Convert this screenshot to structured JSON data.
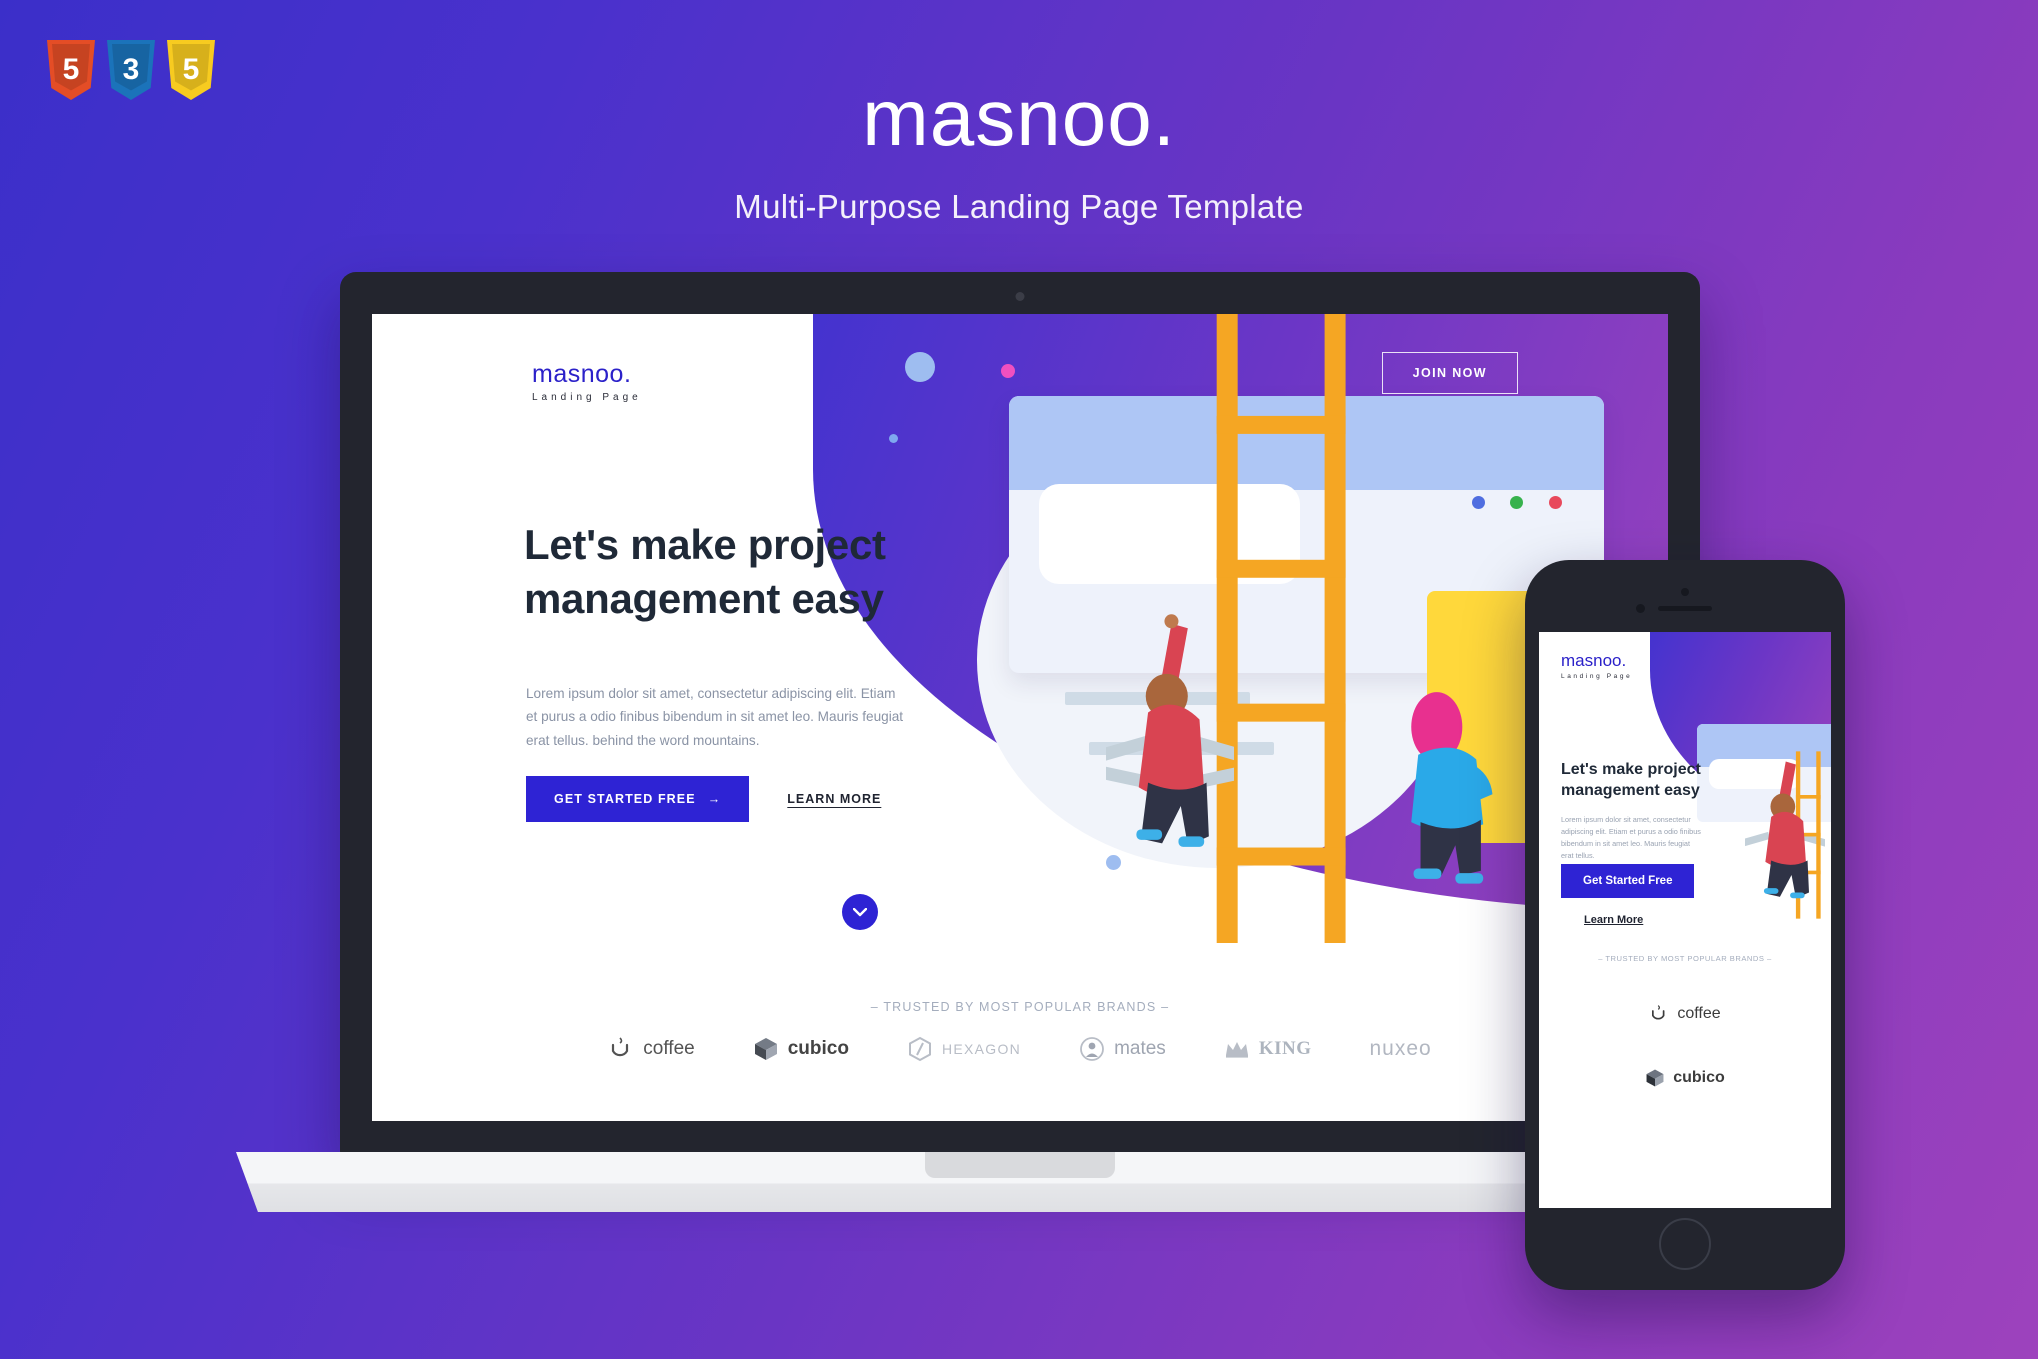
{
  "badges": [
    {
      "name": "html5-badge",
      "char": "5",
      "color": "#e44d26"
    },
    {
      "name": "css3-badge",
      "char": "3",
      "color": "#1b73ba"
    },
    {
      "name": "js-badge",
      "char": "5",
      "color": "#f7cb20"
    }
  ],
  "header": {
    "title": "masnoo.",
    "subtitle": "Multi-Purpose Landing Page Template"
  },
  "colors": {
    "brand_blue": "#2e23d4",
    "logo_blue": "#2b21c9",
    "heading_navy": "#1f2937",
    "body_gray": "#8a93a5",
    "bg_purple_start": "#3b2fc9",
    "bg_purple_end": "#9d42bd",
    "device_dark": "#23252e",
    "yellow_card": "#ffd83b"
  },
  "desktop": {
    "logo": {
      "main": "masnoo.",
      "sub": "Landing Page"
    },
    "nav_button": "JOIN NOW",
    "heading": "Let's make project management easy",
    "paragraph": "Lorem ipsum dolor sit amet, consectetur adipiscing elit. Etiam et purus a odio finibus bibendum in sit amet leo. Mauris feugiat erat tellus. behind the word mountains.",
    "primary_cta": "GET STARTED FREE",
    "primary_cta_arrow": "→",
    "secondary_cta": "LEARN MORE",
    "scroll_icon": "⌄",
    "trusted_label": "– TRUSTED BY MOST POPULAR BRANDS –",
    "brands": [
      {
        "name": "coffee",
        "icon": "coffee-cup-icon"
      },
      {
        "name": "cubico",
        "icon": "cube-icon"
      },
      {
        "name": "HEXAGON",
        "icon": "hexagon-icon"
      },
      {
        "name": "mates",
        "icon": "person-circle-icon"
      },
      {
        "name": "KING",
        "icon": "crown-icon"
      },
      {
        "name": "nuxeo",
        "icon": "x-mark-icon"
      }
    ]
  },
  "mobile": {
    "logo": {
      "main": "masnoo.",
      "sub": "Landing Page"
    },
    "heading": "Let's make project management easy",
    "paragraph": "Lorem ipsum dolor sit amet, consectetur adipiscing elit. Etiam et purus a odio finibus bibendum in sit amet leo. Mauris feugiat erat tellus.",
    "primary_cta": "Get Started Free",
    "secondary_cta": "Learn More",
    "trusted_label": "– TRUSTED BY MOST POPULAR BRANDS –",
    "brands": [
      {
        "name": "coffee",
        "icon": "coffee-cup-icon"
      },
      {
        "name": "cubico",
        "icon": "cube-icon"
      }
    ]
  }
}
